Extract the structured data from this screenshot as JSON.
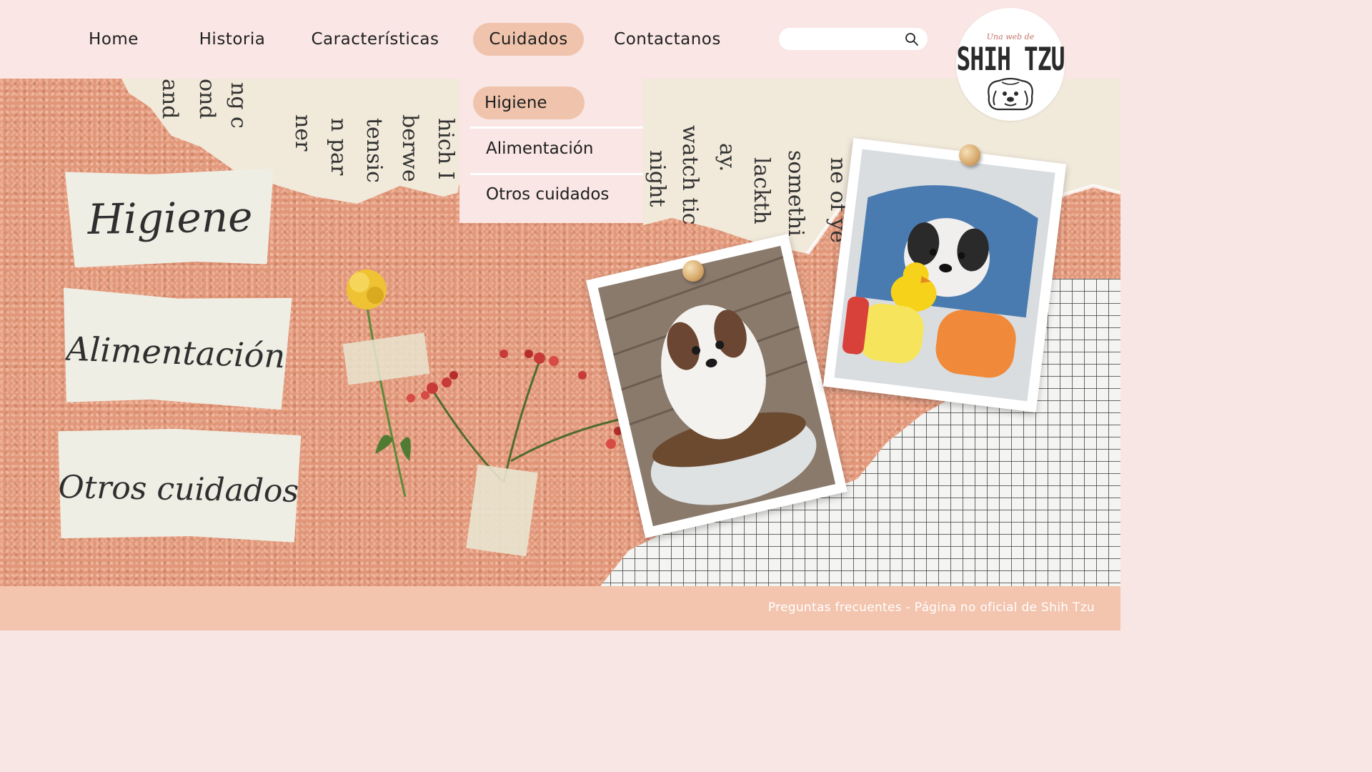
{
  "nav": {
    "items": [
      {
        "label": "Home"
      },
      {
        "label": "Historia"
      },
      {
        "label": "Características"
      },
      {
        "label": "Cuidados"
      },
      {
        "label": "Contactanos"
      }
    ],
    "active": "Cuidados"
  },
  "search": {
    "placeholder": "",
    "icon": "search-icon"
  },
  "logo": {
    "tagline": "Una web de",
    "brand": "SHIH TZU",
    "icon": "shih-tzu-dog-icon"
  },
  "dropdown": {
    "items": [
      {
        "label": "Higiene"
      },
      {
        "label": "Alimentación"
      },
      {
        "label": "Otros cuidados"
      }
    ],
    "active": "Higiene"
  },
  "collage": {
    "labels": [
      {
        "text": "Higiene"
      },
      {
        "text": "Alimentación"
      },
      {
        "text": "Otros cuidados"
      }
    ],
    "newspaper_words": [
      "and",
      "ond",
      "ng c",
      "ner",
      "n par",
      "tensic",
      "berwe",
      "hich I",
      "night",
      "watch tic",
      "ay.",
      "lackth",
      "somethi",
      "ne of ye"
    ]
  },
  "footer": {
    "text": "Preguntas frecuentes - Página no oficial de Shih Tzu"
  },
  "colors": {
    "nav_bg": "#f9e6e5",
    "active_pill": "#f0c4ac",
    "cork": "#e2977a",
    "footer_bg": "#f3c4ae"
  }
}
